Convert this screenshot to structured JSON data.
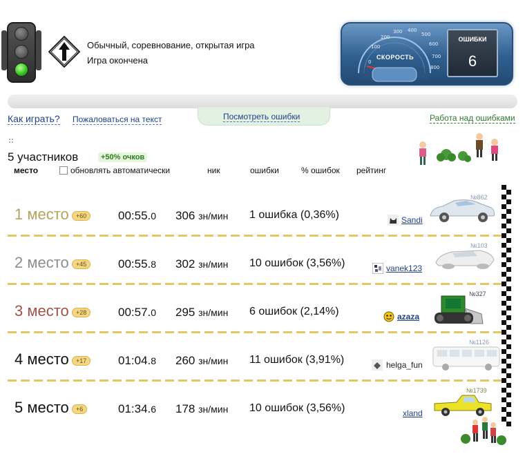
{
  "header": {
    "game_type": "Обычный, соревнование, открытая игра",
    "game_status": "Игра окончена",
    "speedometer_label": "СКОРОСТЬ",
    "speed_ticks": [
      "0",
      "100",
      "200",
      "300",
      "400",
      "500",
      "600",
      "700",
      "800"
    ],
    "errors_label": "ОШИБКИ",
    "errors_count": "6"
  },
  "links": {
    "how_to_play": "Как играть?",
    "complain": "Пожаловаться на текст",
    "view_errors": "Посмотреть ошибки",
    "work_on_errors": "Работа над ошибками"
  },
  "summary": {
    "participants": "5 участников",
    "bonus": "+50% очков"
  },
  "columns": {
    "place": "место",
    "auto_update": "обновлять автоматически",
    "nick": "ник",
    "errors": "ошибки",
    "error_percent": "% ошибок",
    "rating": "рейтинг"
  },
  "results": [
    {
      "place": "1 место",
      "badge": "+60",
      "time_main": "00:55.",
      "time_frac": "0",
      "speed": "306",
      "speed_unit": "зн/мин",
      "errors": "1 ошибка (0,36%)",
      "nick": "Sandi",
      "rank": "№862",
      "place_color": "#b5a35a",
      "car": "silver-sedan"
    },
    {
      "place": "2 место",
      "badge": "+45",
      "time_main": "00:55.",
      "time_frac": "8",
      "speed": "302",
      "speed_unit": "зн/мин",
      "errors": "10 ошибок (3,56%)",
      "nick": "vanek123",
      "rank": "№103",
      "place_color": "#8e8e8e",
      "car": "futuristic-car"
    },
    {
      "place": "3 место",
      "badge": "+28",
      "time_main": "00:57.",
      "time_frac": "0",
      "speed": "295",
      "speed_unit": "зн/мин",
      "errors": "6 ошибок (2,14%)",
      "nick": "azaza",
      "rank": "№327",
      "place_color": "#a0524a",
      "car": "green-bulldozer"
    },
    {
      "place": "4 место",
      "badge": "+17",
      "time_main": "01:04.",
      "time_frac": "8",
      "speed": "260",
      "speed_unit": "зн/мин",
      "errors": "11 ошибок (3,91%)",
      "nick": "helga_fun",
      "rank": "№1126",
      "place_color": "#111111",
      "car": "white-bus"
    },
    {
      "place": "5 место",
      "badge": "+6",
      "time_main": "01:34.",
      "time_frac": "6",
      "speed": "178",
      "speed_unit": "зн/мин",
      "errors": "10 ошибок (3,56%)",
      "nick": "xland",
      "rank": "№1739",
      "place_color": "#111111",
      "car": "yellow-pickup"
    }
  ],
  "colors": {
    "link": "#1f3f8a",
    "green_link": "#2f7a2f",
    "separator": "#e2c766",
    "badge": "#f4d784"
  }
}
